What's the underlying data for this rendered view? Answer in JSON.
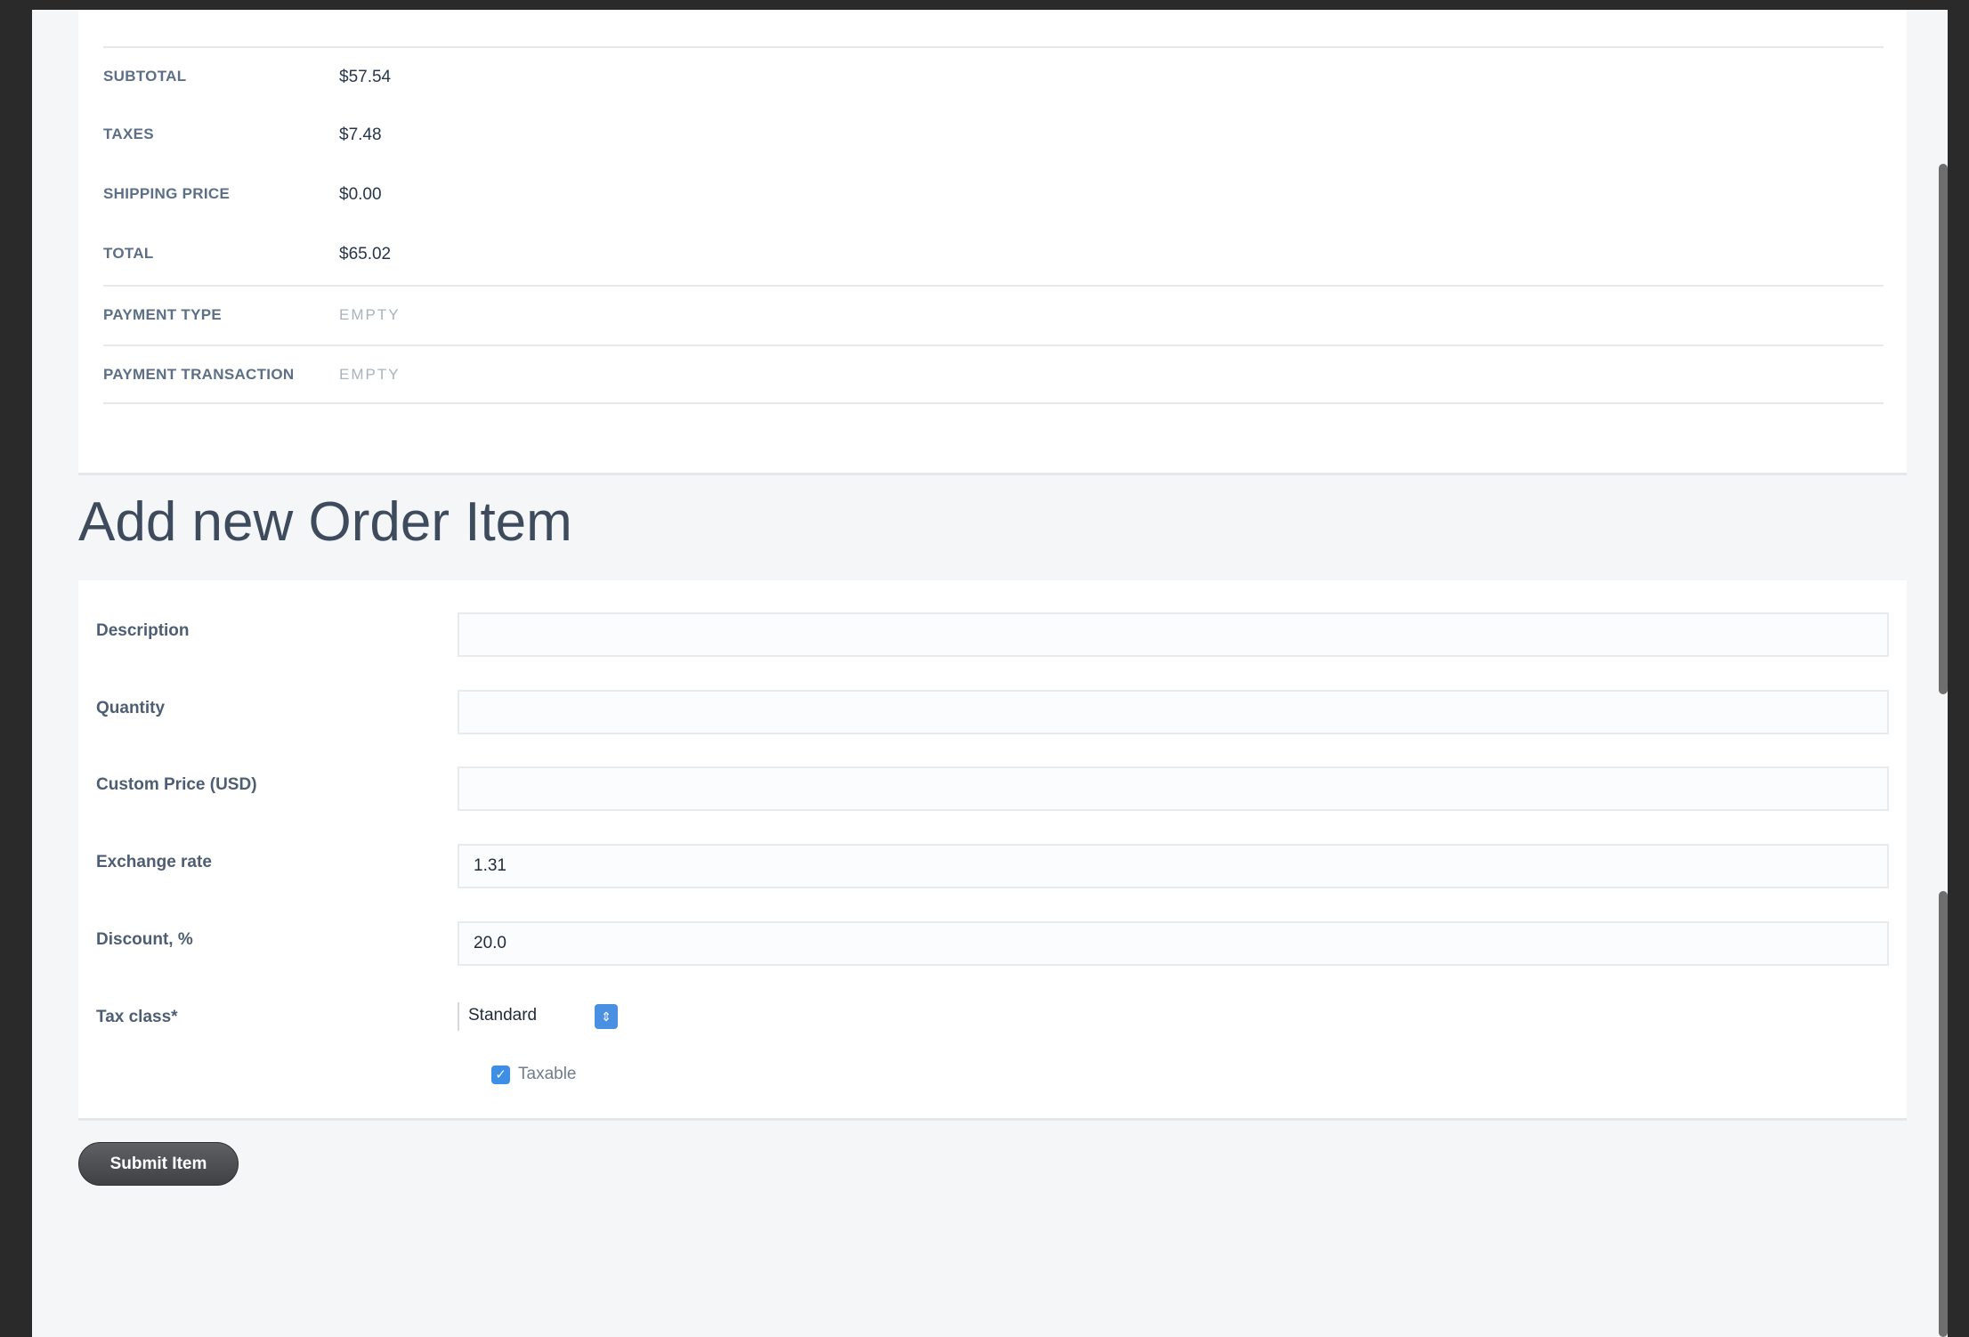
{
  "summary": {
    "rows": [
      {
        "label": "SUBTOTAL",
        "value": "$57.54"
      },
      {
        "label": "TAXES",
        "value": "$7.48"
      },
      {
        "label": "SHIPPING PRICE",
        "value": "$0.00"
      },
      {
        "label": "TOTAL",
        "value": "$65.02"
      },
      {
        "label": "PAYMENT TYPE",
        "value": "EMPTY"
      },
      {
        "label": "PAYMENT TRANSACTION",
        "value": "EMPTY"
      }
    ]
  },
  "page": {
    "title": "Add new Order Item"
  },
  "form": {
    "description_label": "Description",
    "description_value": "",
    "quantity_label": "Quantity",
    "quantity_value": "",
    "custom_price_label": "Custom Price (USD)",
    "custom_price_value": "",
    "exchange_rate_label": "Exchange rate",
    "exchange_rate_value": "1.31",
    "discount_label": "Discount, %",
    "discount_value": "20.0",
    "tax_class_label": "Tax class*",
    "tax_class_selected": "Standard",
    "taxable_label": "Taxable",
    "taxable_checked": true,
    "submit_label": "Submit Item"
  },
  "colors": {
    "accent": "#4a90e2",
    "button": "#4a4c4f"
  },
  "icons": {
    "select_arrow": "updown-arrows-icon",
    "checkbox": "checkmark-icon"
  }
}
